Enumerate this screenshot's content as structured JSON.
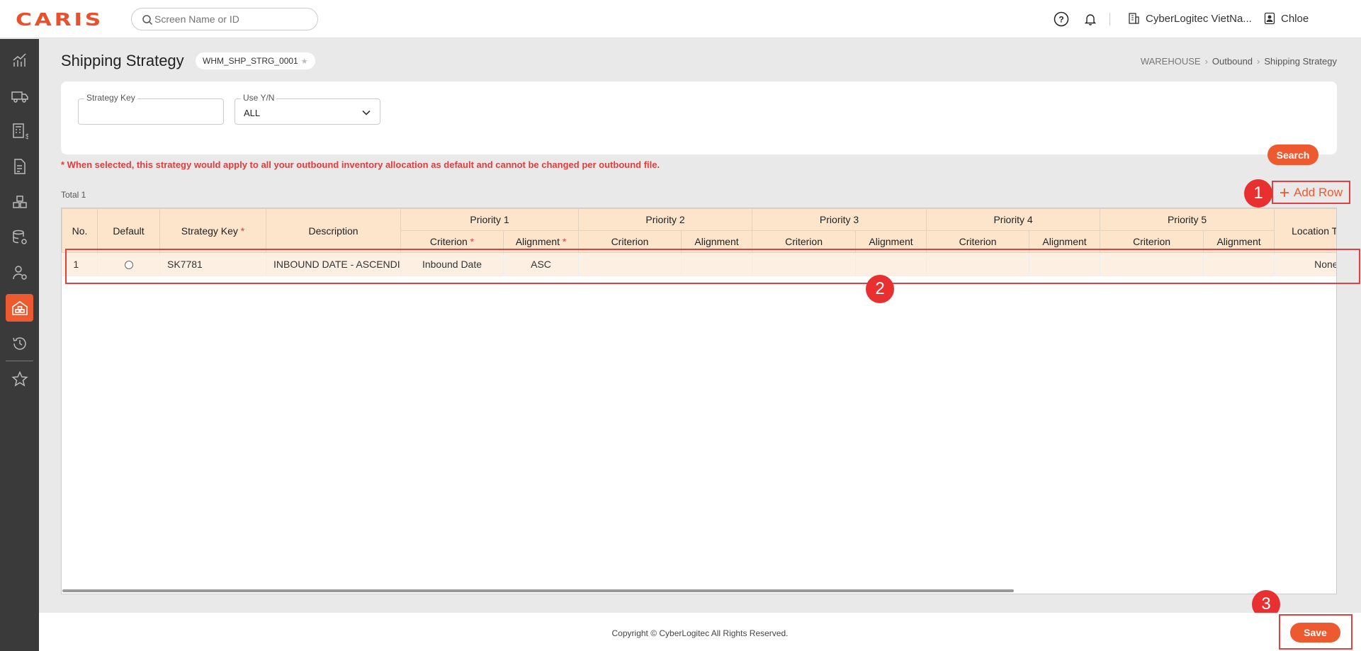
{
  "app": {
    "logo": "CARIS",
    "search_placeholder": "Screen Name or ID",
    "company": "CyberLogitec VietNa...",
    "user": "Chloe"
  },
  "page": {
    "title": "Shipping Strategy",
    "screen_id": "WHM_SHP_STRG_0001",
    "breadcrumb": [
      "WAREHOUSE",
      "Outbound",
      "Shipping Strategy"
    ]
  },
  "filters": {
    "strategy_key": {
      "label": "Strategy Key",
      "value": ""
    },
    "use_yn": {
      "label": "Use Y/N",
      "value": "ALL"
    }
  },
  "buttons": {
    "search": "Search",
    "add_row": "Add Row",
    "save": "Save"
  },
  "note": "* When selected, this strategy would apply to all your outbound inventory allocation as default and cannot be changed per outbound file.",
  "grid": {
    "total": "Total 1",
    "headers": {
      "no": "No.",
      "default": "Default",
      "strategy_key": "Strategy Key",
      "description": "Description",
      "priority1": "Priority 1",
      "priority2": "Priority 2",
      "priority3": "Priority 3",
      "priority4": "Priority 4",
      "priority5": "Priority 5",
      "criterion": "Criterion",
      "alignment": "Alignment",
      "location": "Location T",
      "required_mark": "*"
    },
    "rows": [
      {
        "no": "1",
        "strategy_key": "SK7781",
        "description": "INBOUND DATE - ASCENDING",
        "p1_criterion": "Inbound Date",
        "p1_alignment": "ASC",
        "location": "None"
      }
    ]
  },
  "annotations": {
    "badge1": "1",
    "badge2": "2",
    "badge3": "3"
  },
  "footer": {
    "copyright": "Copyright © CyberLogitec All Rights Reserved."
  },
  "colors": {
    "accent": "#ee5a2f",
    "header_bg": "#fde5cc",
    "row_bg": "#fdf0e3",
    "sidebar": "#3a3a3a",
    "annotation": "#e83030"
  }
}
